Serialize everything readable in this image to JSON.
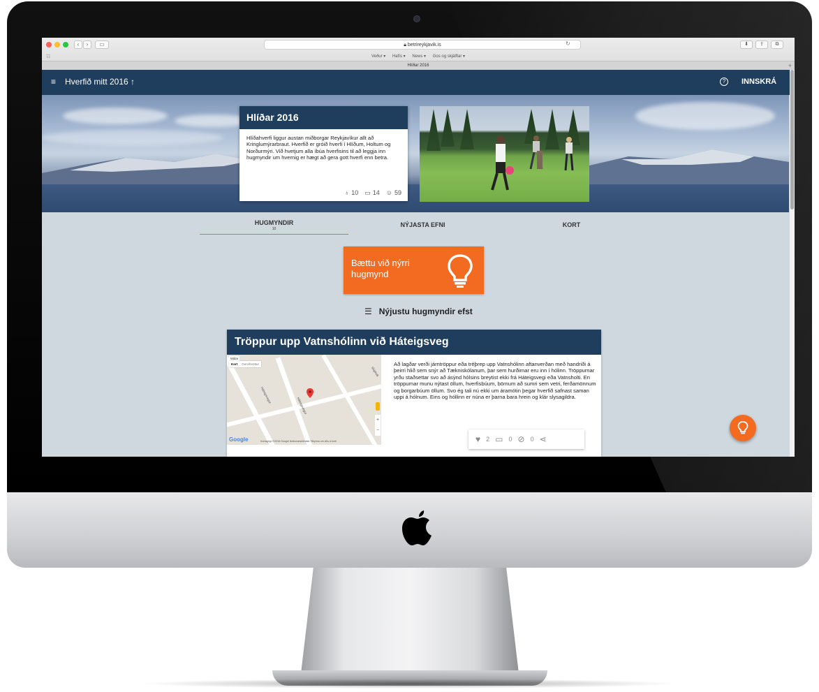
{
  "browser": {
    "url": "betrireykjavik.is",
    "favorites": [
      "Veður ▾",
      "Hafís ▾",
      "News ▾",
      "Gos og skjálftar ▾"
    ],
    "tab_title": "Hlíðar 2016"
  },
  "appbar": {
    "title": "Hverfið mitt 2016",
    "login": "INNSKRÁ",
    "color": "#1f3d5c"
  },
  "hero": {
    "title": "Hlíðar 2016",
    "description": "Hlíðahverfi liggur austan miðborgar Reykjavíkur allt að Kringlumýrarbraut. Hverfið er gróið hverfi í Hlíðum, Holtum og Norðurmýri. Við hvetjum alla íbúa hverfisins til að leggja inn hugmyndir um hvernig er hægt að gera gott hverfi enn betra.",
    "stats": {
      "ideas": "10",
      "comments": "14",
      "users": "59"
    }
  },
  "tabs": [
    {
      "label": "HUGMYNDIR",
      "count": "10"
    },
    {
      "label": "NÝJASTA EFNI"
    },
    {
      "label": "KORT"
    }
  ],
  "add_idea": {
    "label": "Bættu við nýrri hugmynd",
    "color": "#f36b21"
  },
  "sort": {
    "label": "Nýjustu hugmyndir efst"
  },
  "idea": {
    "title": "Tröppur upp Vatnshólinn við Háteigsveg",
    "text": "Að lagðar verði járntröppur eða tréþrep upp Vatnshólinn aftanverðan með handriði á þeirri hlið sem snýr að Tækniskólanum, þar sem hurðirnar eru inn í hólinn. Tröppurnar yrðu staðsettar svo að ásýnd hólsins breytist ekki frá Háteigsvegi eða Vatnsholti. En tröppurnar munu nýtast öllum, hverfisbúum, börnum að sumri sem vetri, ferðamönnum og borgarbúum öllum. Svo ég tali nú ekki um áramótin þegar hverfið safnast saman uppi á hólnum. Eins og hóllinn er núna er þarna bara hrein og klár slysagildra.",
    "likes": "2",
    "comments": "0",
    "dislikes": "0",
    "map": {
      "top_label": "Múlar",
      "toggle": [
        "Kort",
        "Gervihnöttur"
      ],
      "streets": [
        "Háteigsvegur",
        "Háteigsvegur",
        "Skipholt"
      ],
      "legal": "Kortagögn ©2016 Google   Notkunarskilmálar   Tilkynna um villu á korti",
      "logo": "Google"
    }
  }
}
